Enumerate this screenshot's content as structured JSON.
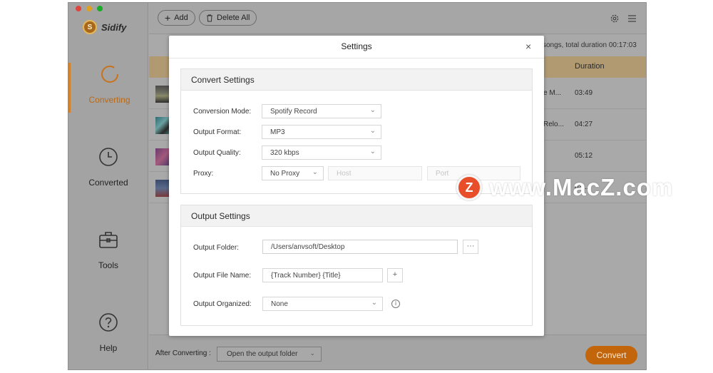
{
  "app": {
    "name": "Sidify",
    "logo_glyph": "S"
  },
  "window_controls": {
    "close_color": "#e0443e",
    "minimize_color": "#dea123",
    "maximize_color": "#1aab29"
  },
  "sidebar": {
    "items": [
      {
        "label": "Converting",
        "icon": "converting-icon",
        "active": true
      },
      {
        "label": "Converted",
        "icon": "clock-icon",
        "active": false
      },
      {
        "label": "Tools",
        "icon": "toolbox-icon",
        "active": false
      },
      {
        "label": "Help",
        "icon": "help-icon",
        "active": false
      }
    ]
  },
  "toolbar": {
    "add_label": "Add",
    "delete_all_label": "Delete All"
  },
  "list": {
    "summary": "songs, total duration 00:17:03",
    "duration_header": "Duration",
    "rows": [
      {
        "title_tail": "e M...",
        "duration": "03:49"
      },
      {
        "title_tail": "Relo...",
        "duration": "04:27"
      },
      {
        "title_tail": "",
        "duration": "05:12"
      },
      {
        "title_tail": "",
        "duration": "03:..."
      }
    ]
  },
  "footer": {
    "after_label": "After Converting :",
    "after_value": "Open the output folder",
    "convert_label": "Convert"
  },
  "dialog": {
    "title": "Settings",
    "close_glyph": "×",
    "convert_settings": {
      "header": "Convert Settings",
      "conversion_mode_label": "Conversion Mode:",
      "conversion_mode_value": "Spotify Record",
      "output_format_label": "Output Format:",
      "output_format_value": "MP3",
      "output_quality_label": "Output Quality:",
      "output_quality_value": "320 kbps",
      "proxy_label": "Proxy:",
      "proxy_value": "No Proxy",
      "host_placeholder": "Host",
      "port_placeholder": "Port"
    },
    "output_settings": {
      "header": "Output Settings",
      "folder_label": "Output Folder:",
      "folder_value": "/Users/anvsoft/Desktop",
      "browse_glyph": "···",
      "file_name_label": "Output File Name:",
      "file_name_value": "{Track Number} {Title}",
      "add_glyph": "+",
      "organized_label": "Output Organized:",
      "organized_value": "None",
      "info_glyph": "i"
    }
  },
  "watermark": {
    "logo_glyph": "Z",
    "text": "www.MacZ.com"
  },
  "colors": {
    "accent": "#d0832a",
    "convert_button": "#c2650b",
    "table_header": "#b19a72",
    "watermark_logo": "#e84e2a"
  }
}
